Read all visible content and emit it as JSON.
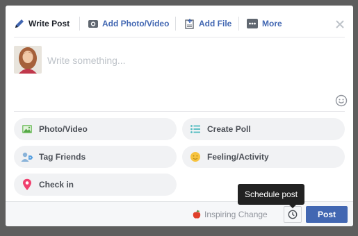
{
  "tabs": [
    {
      "label": "Write Post",
      "icon": "pencil-icon",
      "active": true
    },
    {
      "label": "Add Photo/Video",
      "icon": "camera-icon",
      "active": false
    },
    {
      "label": "Add File",
      "icon": "file-add-icon",
      "active": false
    },
    {
      "label": "More",
      "icon": "more-icon",
      "active": false
    }
  ],
  "composer": {
    "placeholder": "Write something..."
  },
  "actions": [
    {
      "label": "Photo/Video",
      "icon": "photo-icon"
    },
    {
      "label": "Create Poll",
      "icon": "poll-icon"
    },
    {
      "label": "Tag Friends",
      "icon": "tag-friends-icon"
    },
    {
      "label": "Feeling/Activity",
      "icon": "feeling-icon"
    },
    {
      "label": "Check in",
      "icon": "location-pin-icon"
    }
  ],
  "footer": {
    "page_name": "Inspiring Change",
    "post_label": "Post",
    "schedule_tooltip": "Schedule post"
  },
  "colors": {
    "brand": "#4267b2",
    "overlay": "#5e5e5e",
    "action_bg": "#f1f2f4"
  }
}
